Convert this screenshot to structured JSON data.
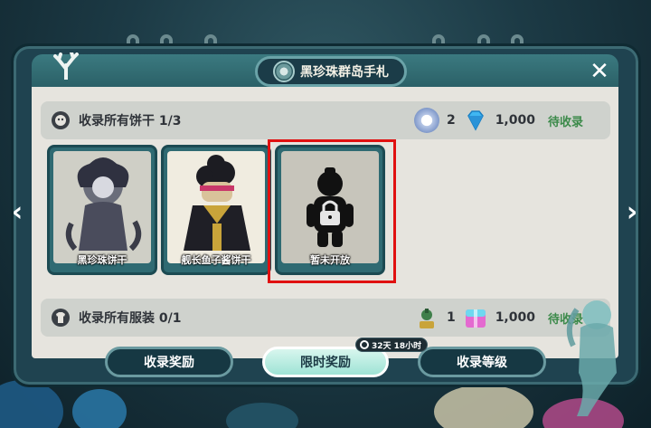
{
  "header": {
    "title": "黑珍珠群岛手札"
  },
  "collections": [
    {
      "label": "收录所有饼干 1/3",
      "rewards": [
        {
          "icon": "cookie-token-icon",
          "count": "2"
        },
        {
          "icon": "crystal-icon",
          "count": "1,000"
        }
      ],
      "status": "待收录"
    },
    {
      "label": "收录所有服装 0/1",
      "rewards": [
        {
          "icon": "costume-token-icon",
          "count": "1"
        },
        {
          "icon": "gift-box-icon",
          "count": "1,000"
        }
      ],
      "status": "待收录"
    }
  ],
  "cards": [
    {
      "name": "黑珍珠饼干",
      "locked": false
    },
    {
      "name": "舰长鱼子酱饼干",
      "locked": false
    },
    {
      "name": "暂未开放",
      "locked": true
    }
  ],
  "buttons": {
    "collect_reward": "收录奖励",
    "limited_reward": "限时奖励",
    "collect_level": "收录等级"
  },
  "timer": "32天 18小时",
  "colors": {
    "accent": "#3c8a4a",
    "highlight": "#e01010",
    "frame": "#1f4350"
  }
}
